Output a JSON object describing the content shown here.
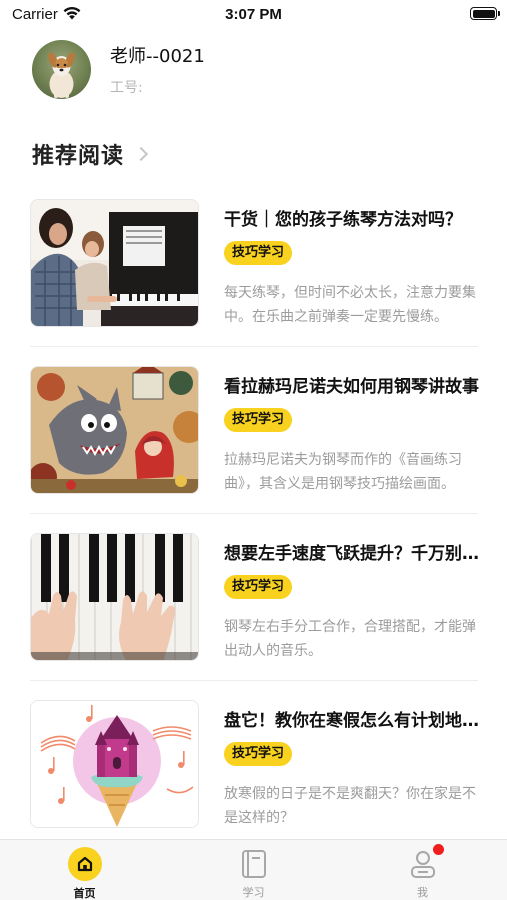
{
  "status_bar": {
    "carrier": "Carrier",
    "time": "3:07 PM"
  },
  "profile": {
    "name": "老师--0021",
    "job_no_label": "工号:"
  },
  "section": {
    "title": "推荐阅读"
  },
  "articles": [
    {
      "title": "干货｜您的孩子练琴方法对吗？",
      "tag": "技巧学习",
      "desc": "每天练琴，但时间不必太长，注意力要集中。在乐曲之前弹奏一定要先慢练。",
      "image": "mother-daughter-piano"
    },
    {
      "title": "看拉赫玛尼诺夫如何用钢琴讲故事",
      "tag": "技巧学习",
      "desc": "拉赫玛尼诺夫为钢琴而作的《音画练习曲》，其含义是用钢琴技巧描绘画面。",
      "image": "wolf-red-riding-hood"
    },
    {
      "title": "想要左手速度飞跃提升？千万别错过",
      "tag": "技巧学习",
      "desc": "钢琴左右手分工合作，合理搭配，才能弹出动人的音乐。",
      "image": "hands-on-keys"
    },
    {
      "title": "盘它！教你在寒假怎么有计划地练琴",
      "tag": "技巧学习",
      "desc": "放寒假的日子是不是爽翻天？你在家是不是这样的？",
      "image": "music-castle-icecream"
    }
  ],
  "tabbar": {
    "items": [
      {
        "label": "首页",
        "icon": "home-icon",
        "active": true
      },
      {
        "label": "学习",
        "icon": "book-icon",
        "active": false
      },
      {
        "label": "我",
        "icon": "person-icon",
        "active": false,
        "badge": true
      }
    ]
  },
  "colors": {
    "accent": "#f8d21e",
    "badge": "#f01d1d",
    "muted_text": "#9c9c9c"
  }
}
